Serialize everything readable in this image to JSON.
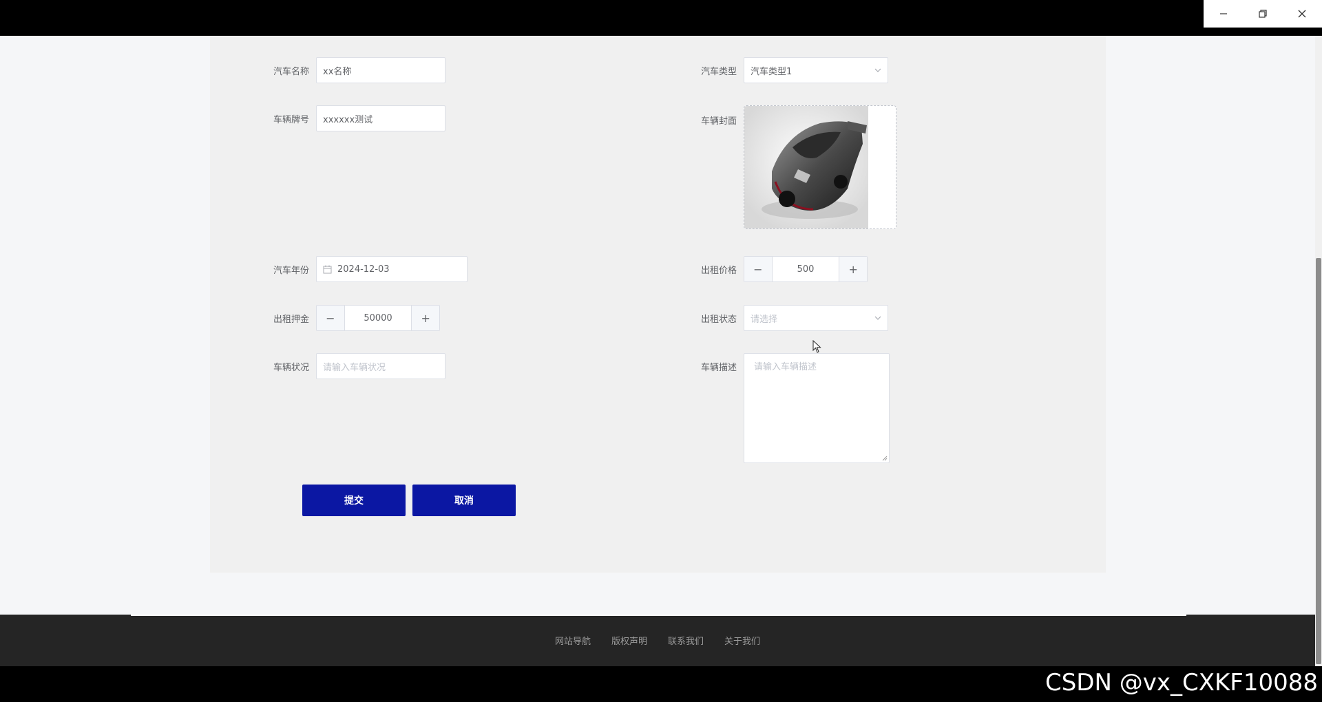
{
  "form": {
    "car_name": {
      "label": "汽车名称",
      "value": "xx名称"
    },
    "car_type": {
      "label": "汽车类型",
      "value": "汽车类型1"
    },
    "plate_number": {
      "label": "车辆牌号",
      "value": "xxxxxx测试"
    },
    "cover": {
      "label": "车辆封面"
    },
    "car_year": {
      "label": "汽车年份",
      "value": "2024-12-03"
    },
    "rent_price": {
      "label": "出租价格",
      "value": "500",
      "minus": "−",
      "plus": "+"
    },
    "deposit": {
      "label": "出租押金",
      "value": "50000",
      "minus": "−",
      "plus": "+"
    },
    "rent_status": {
      "label": "出租状态",
      "placeholder": "请选择"
    },
    "condition": {
      "label": "车辆状况",
      "placeholder": "请输入车辆状况"
    },
    "description": {
      "label": "车辆描述",
      "placeholder": "请输入车辆描述"
    }
  },
  "buttons": {
    "submit": "提交",
    "cancel": "取消"
  },
  "footer": {
    "links": [
      "网站导航",
      "版权声明",
      "联系我们",
      "关于我们"
    ]
  },
  "watermark": "CSDN @vx_CXKF10088",
  "colors": {
    "primary_button": "#0b17a3",
    "footer_bg": "#252525",
    "card_bg": "#f0f0f0"
  }
}
